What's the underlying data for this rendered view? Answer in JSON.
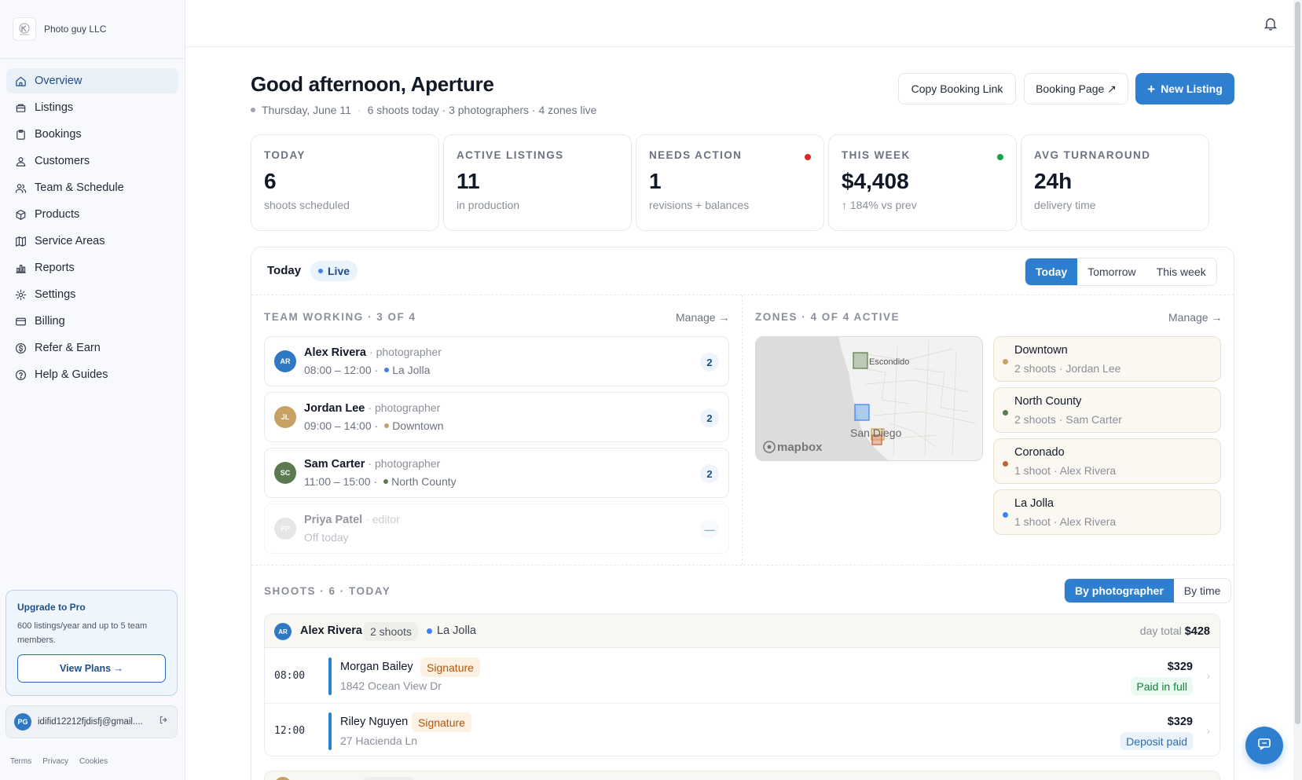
{
  "brand": {
    "name": "Photo guy LLC"
  },
  "nav": [
    {
      "label": "Overview",
      "icon": "home-icon",
      "active": true
    },
    {
      "label": "Listings",
      "icon": "listings-icon"
    },
    {
      "label": "Bookings",
      "icon": "clipboard-icon"
    },
    {
      "label": "Customers",
      "icon": "customers-icon"
    },
    {
      "label": "Team & Schedule",
      "icon": "team-icon"
    },
    {
      "label": "Products",
      "icon": "box-icon"
    },
    {
      "label": "Service Areas",
      "icon": "map-icon"
    },
    {
      "label": "Reports",
      "icon": "chart-icon"
    },
    {
      "label": "Settings",
      "icon": "gear-icon"
    },
    {
      "label": "Billing",
      "icon": "card-icon"
    },
    {
      "label": "Refer & Earn",
      "icon": "dollar-icon"
    },
    {
      "label": "Help & Guides",
      "icon": "help-icon"
    }
  ],
  "upgrade": {
    "title": "Upgrade to Pro",
    "description": "600 listings/year and up to 5 team members.",
    "button": "View Plans →"
  },
  "account": {
    "initials": "PG",
    "email": "idifid12212fjdisfj@gmail...."
  },
  "footer": {
    "terms": "Terms",
    "privacy": "Privacy",
    "cookies": "Cookies"
  },
  "header": {
    "greeting": "Good afternoon, Aperture",
    "date": "Thursday, June 11",
    "summary": "6 shoots today · 3 photographers · 4 zones live",
    "copy_link": "Copy Booking Link",
    "booking_page": "Booking Page ↗",
    "new_listing": "New Listing"
  },
  "stats": [
    {
      "label": "TODAY",
      "value": "6",
      "note": "shoots scheduled"
    },
    {
      "label": "ACTIVE LISTINGS",
      "value": "11",
      "note": "in production"
    },
    {
      "label": "NEEDS ACTION",
      "value": "1",
      "note": "revisions + balances",
      "dot": "#dc2626"
    },
    {
      "label": "THIS WEEK",
      "value": "$4,408",
      "note": "↑ 184% vs prev",
      "dot": "#16a34a"
    },
    {
      "label": "AVG TURNAROUND",
      "value": "24h",
      "note": "delivery time"
    }
  ],
  "today": {
    "title": "Today",
    "live": "Live",
    "tabs": [
      "Today",
      "Tomorrow",
      "This week"
    ],
    "active_tab": "Today"
  },
  "team": {
    "label": "TEAM WORKING · 3 OF 4",
    "manage": "Manage →",
    "members": [
      {
        "initials": "AR",
        "name": "Alex Rivera",
        "role": "· photographer",
        "time": "08:00 – 12:00 ·",
        "zone": "La Jolla",
        "zone_color": "#3b82f6",
        "count": "2",
        "color": "#2f78c4"
      },
      {
        "initials": "JL",
        "name": "Jordan Lee",
        "role": "· photographer",
        "time": "09:00 – 14:00 ·",
        "zone": "Downtown",
        "zone_color": "#c6a163",
        "count": "2",
        "color": "#c6a163"
      },
      {
        "initials": "SC",
        "name": "Sam Carter",
        "role": "· photographer",
        "time": "11:00 – 15:00 ·",
        "zone": "North County",
        "zone_color": "#5b7a4f",
        "count": "2",
        "color": "#5b7a4f"
      },
      {
        "initials": "PP",
        "name": "Priya Patel",
        "role": "· editor",
        "time": "Off today",
        "zone": "",
        "count": "—",
        "color": "#c9c9c9",
        "off": true
      }
    ]
  },
  "zones": {
    "label": "ZONES · 4 OF 4 ACTIVE",
    "manage": "Manage →",
    "map": {
      "city1": "Escondido",
      "city2": "San Diego",
      "attribution": "mapbox"
    },
    "items": [
      {
        "name": "Downtown",
        "info": "2 shoots · Jordan Lee",
        "color": "#c6a163"
      },
      {
        "name": "North County",
        "info": "2 shoots · Sam Carter",
        "color": "#5b7a4f"
      },
      {
        "name": "Coronado",
        "info": "1 shoot · Alex Rivera",
        "color": "#c2603b"
      },
      {
        "name": "La Jolla",
        "info": "1 shoot · Alex Rivera",
        "color": "#3b82f6"
      }
    ]
  },
  "shoots": {
    "label": "SHOOTS · 6 · TODAY",
    "views": [
      "By photographer",
      "By time"
    ],
    "active_view": "By photographer",
    "group": {
      "initials": "AR",
      "name": "Alex Rivera",
      "count": "2 shoots",
      "zone": "La Jolla",
      "total_label": "day total",
      "total": "$428",
      "items": [
        {
          "time": "08:00",
          "client": "Morgan Bailey",
          "package": "Signature",
          "address": "1842 Ocean View Dr",
          "price": "$329",
          "payment": "Paid in full",
          "pay_status": "paid"
        },
        {
          "time": "12:00",
          "client": "Riley Nguyen",
          "package": "Signature",
          "address": "27 Hacienda Ln",
          "price": "$329",
          "payment": "Deposit paid",
          "pay_status": "deposit"
        }
      ]
    }
  }
}
